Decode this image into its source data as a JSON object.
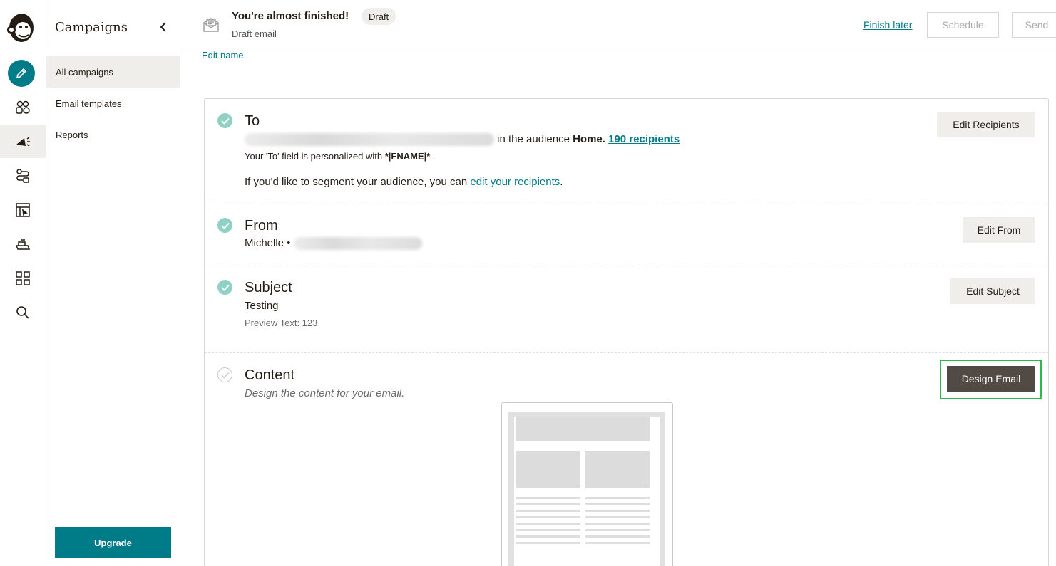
{
  "rail": {
    "icons": [
      "mailchimp-logo-icon",
      "pencil-icon",
      "audience-icon",
      "megaphone-icon",
      "automation-icon",
      "website-icon",
      "content-icon",
      "integrations-icon",
      "search-icon"
    ]
  },
  "subnav": {
    "title": "Campaigns",
    "items": [
      {
        "label": "All campaigns",
        "active": true
      },
      {
        "label": "Email templates",
        "active": false
      },
      {
        "label": "Reports",
        "active": false
      }
    ],
    "upgrade_label": "Upgrade"
  },
  "header": {
    "title": "You're almost finished!",
    "badge": "Draft",
    "subtitle": "Draft email",
    "finish_later": "Finish later",
    "schedule": "Schedule",
    "send": "Send"
  },
  "edit_name": "Edit name",
  "sections": {
    "to": {
      "title": "To",
      "audience_prefix": "in the audience",
      "audience_name": "Home.",
      "recipients": "190 recipients",
      "personalized_prefix": "Your 'To' field is personalized with",
      "merge_tag": "*|FNAME|*",
      "personalized_suffix": ".",
      "segment_prefix": "If you'd like to segment your audience, you can",
      "segment_link": "edit your recipients",
      "segment_suffix": ".",
      "button": "Edit Recipients"
    },
    "from": {
      "title": "From",
      "name": "Michelle •",
      "button": "Edit From"
    },
    "subject": {
      "title": "Subject",
      "value": "Testing",
      "preview_text": "Preview Text: 123",
      "button": "Edit Subject"
    },
    "content": {
      "title": "Content",
      "hint": "Design the content for your email.",
      "button": "Design Email"
    }
  },
  "colors": {
    "accent": "#007c89",
    "check_done": "#8fd1c3",
    "highlight_border": "#2fb84a",
    "design_button": "#524a44"
  }
}
